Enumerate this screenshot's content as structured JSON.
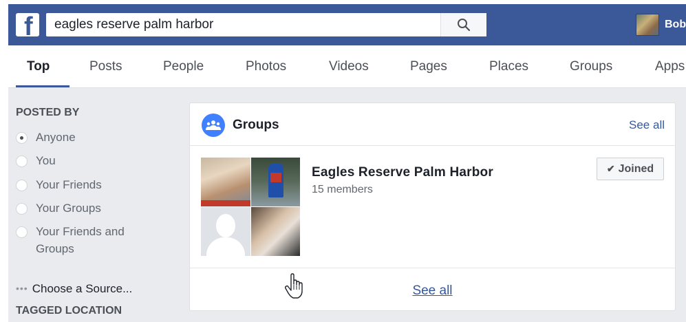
{
  "header": {
    "search_value": "eagles reserve palm harbor",
    "user_name": "Bob",
    "logo_letter": "f"
  },
  "tabs": [
    {
      "label": "Top",
      "active": true
    },
    {
      "label": "Posts"
    },
    {
      "label": "People"
    },
    {
      "label": "Photos"
    },
    {
      "label": "Videos"
    },
    {
      "label": "Pages"
    },
    {
      "label": "Places"
    },
    {
      "label": "Groups"
    },
    {
      "label": "Apps"
    }
  ],
  "sidebar": {
    "posted_by_heading": "POSTED BY",
    "options": [
      {
        "label": "Anyone",
        "checked": true
      },
      {
        "label": "You"
      },
      {
        "label": "Your Friends"
      },
      {
        "label": "Your Groups"
      },
      {
        "label": "Your Friends and Groups"
      }
    ],
    "choose_source": "Choose a Source...",
    "tagged_location_heading": "TAGGED LOCATION"
  },
  "groups_card": {
    "title": "Groups",
    "see_all_top": "See all",
    "group": {
      "name": "Eagles Reserve Palm Harbor",
      "members": "15 members",
      "joined_label": "Joined"
    },
    "see_all_bottom": "See all"
  },
  "icons": [
    "facebook-logo-icon",
    "search-icon",
    "groups-icon",
    "check-icon",
    "hand-cursor-icon",
    "more-dots-icon"
  ],
  "colors": {
    "brand": "#3b5998",
    "link": "#365899",
    "groups_icon_bg": "#4080ff",
    "page_bg": "#e9ebee"
  }
}
